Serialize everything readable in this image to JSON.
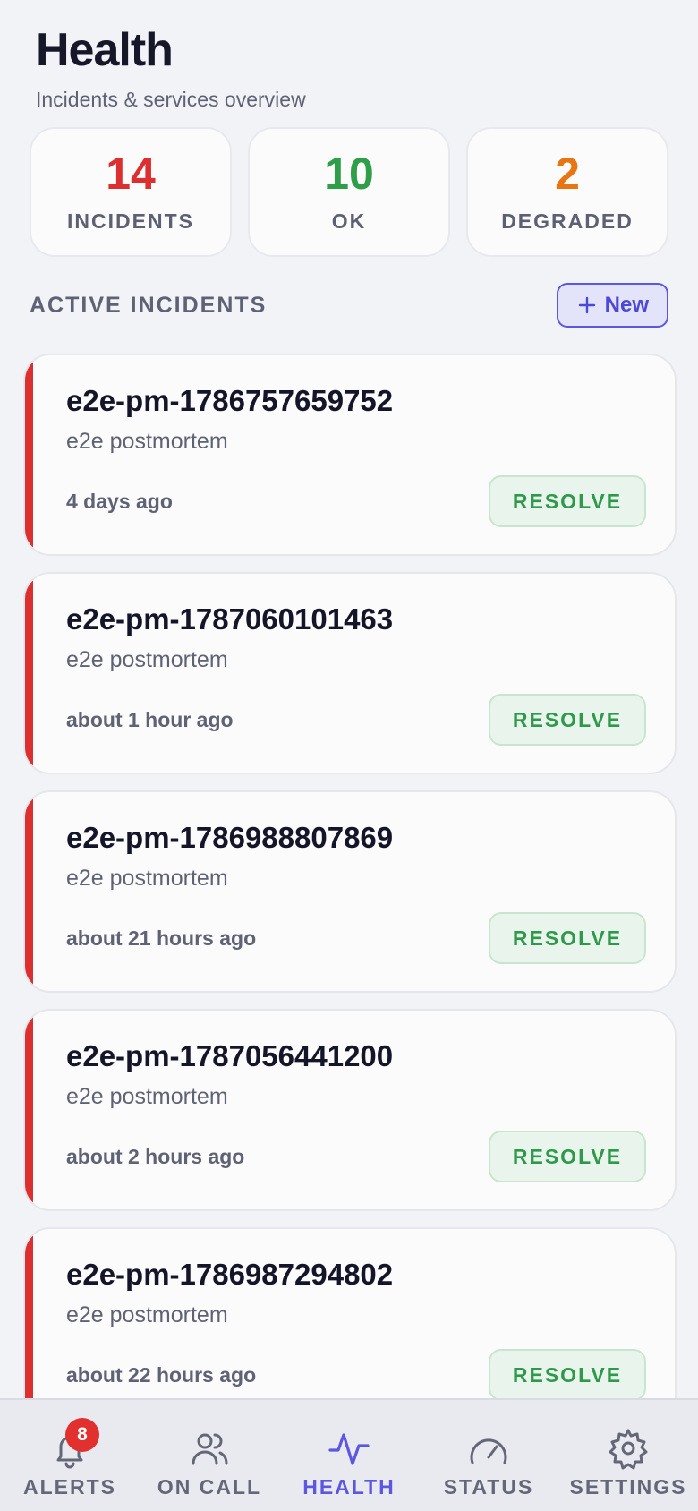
{
  "header": {
    "title": "Health",
    "subtitle": "Incidents & services overview"
  },
  "stats": [
    {
      "value": "14",
      "label": "INCIDENTS",
      "color": "#dc2f2f"
    },
    {
      "value": "10",
      "label": "OK",
      "color": "#2f9e48"
    },
    {
      "value": "2",
      "label": "DEGRADED",
      "color": "#e97512"
    }
  ],
  "section": {
    "title": "ACTIVE INCIDENTS",
    "new_label": "New"
  },
  "incidents": [
    {
      "title": "e2e-pm-1786757659752",
      "description": "e2e postmortem",
      "time": "4 days ago",
      "action": "RESOLVE"
    },
    {
      "title": "e2e-pm-1787060101463",
      "description": "e2e postmortem",
      "time": "about 1 hour ago",
      "action": "RESOLVE"
    },
    {
      "title": "e2e-pm-1786988807869",
      "description": "e2e postmortem",
      "time": "about 21 hours ago",
      "action": "RESOLVE"
    },
    {
      "title": "e2e-pm-1787056441200",
      "description": "e2e postmortem",
      "time": "about 2 hours ago",
      "action": "RESOLVE"
    },
    {
      "title": "e2e-pm-1786987294802",
      "description": "e2e postmortem",
      "time": "about 22 hours ago",
      "action": "RESOLVE"
    }
  ],
  "tabs": [
    {
      "label": "ALERTS",
      "icon": "bell-icon",
      "badge": "8"
    },
    {
      "label": "ON CALL",
      "icon": "users-icon"
    },
    {
      "label": "HEALTH",
      "icon": "activity-icon",
      "active": true
    },
    {
      "label": "STATUS",
      "icon": "gauge-icon"
    },
    {
      "label": "SETTINGS",
      "icon": "gear-icon"
    }
  ],
  "colors": {
    "accent": "#5b57e0",
    "danger": "#dc2f2f",
    "success": "#2f9e48"
  }
}
